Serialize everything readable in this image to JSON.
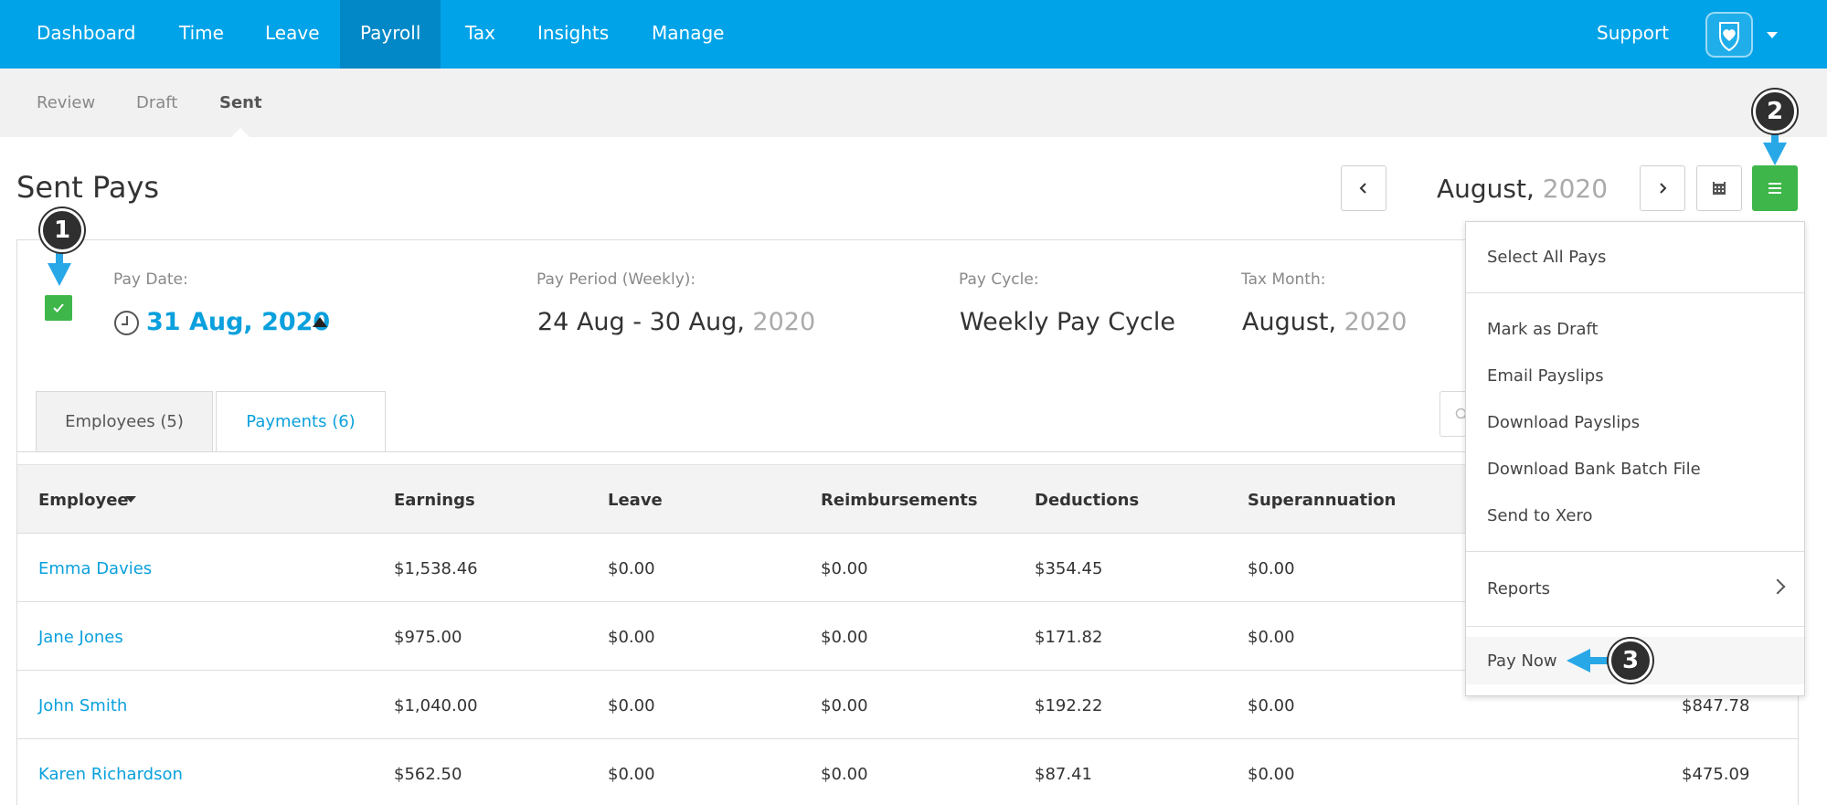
{
  "nav": {
    "items": [
      "Dashboard",
      "Time",
      "Leave",
      "Payroll",
      "Tax",
      "Insights",
      "Manage"
    ],
    "active": "Payroll",
    "support": "Support"
  },
  "subnav": {
    "items": [
      "Review",
      "Draft",
      "Sent"
    ],
    "active": "Sent"
  },
  "page": {
    "title": "Sent Pays",
    "month": "August,",
    "year": "2020"
  },
  "pay_info": {
    "pay_date_label": "Pay Date:",
    "pay_date_value": "31 Aug, 2020",
    "pay_period_label": "Pay Period (Weekly):",
    "pay_period_value": "24 Aug - 30 Aug,",
    "pay_period_year": "2020",
    "pay_cycle_label": "Pay Cycle:",
    "pay_cycle_value": "Weekly Pay Cycle",
    "tax_month_label": "Tax Month:",
    "tax_month_value": "August,",
    "tax_month_year": "2020"
  },
  "tabs": {
    "employees": "Employees (5)",
    "payments": "Payments (6)"
  },
  "table": {
    "headers": [
      "Employee",
      "Earnings",
      "Leave",
      "Reimbursements",
      "Deductions",
      "Superannuation"
    ],
    "rows": [
      {
        "employee": "Emma Davies",
        "earnings": "$1,538.46",
        "leave": "$0.00",
        "reimbursements": "$0.00",
        "deductions": "$354.45",
        "superannuation": "$0.00",
        "net": ""
      },
      {
        "employee": "Jane Jones",
        "earnings": "$975.00",
        "leave": "$0.00",
        "reimbursements": "$0.00",
        "deductions": "$171.82",
        "superannuation": "$0.00",
        "net": ""
      },
      {
        "employee": "John Smith",
        "earnings": "$1,040.00",
        "leave": "$0.00",
        "reimbursements": "$0.00",
        "deductions": "$192.22",
        "superannuation": "$0.00",
        "net": "$847.78"
      },
      {
        "employee": "Karen Richardson",
        "earnings": "$562.50",
        "leave": "$0.00",
        "reimbursements": "$0.00",
        "deductions": "$87.41",
        "superannuation": "$0.00",
        "net": "$475.09"
      }
    ]
  },
  "menu": {
    "select_all": "Select All Pays",
    "mark_draft": "Mark as Draft",
    "email_payslips": "Email Payslips",
    "download_payslips": "Download Payslips",
    "download_bank": "Download Bank Batch File",
    "send_xero": "Send to Xero",
    "reports": "Reports",
    "pay_now": "Pay Now"
  },
  "callouts": [
    "1",
    "2",
    "3"
  ],
  "colors": {
    "nav_bg": "#00a3e8",
    "nav_active": "#0288c6",
    "accent_green": "#3eb649",
    "link_blue": "#0aa0dd",
    "callout_arrow": "#29a8e8"
  }
}
